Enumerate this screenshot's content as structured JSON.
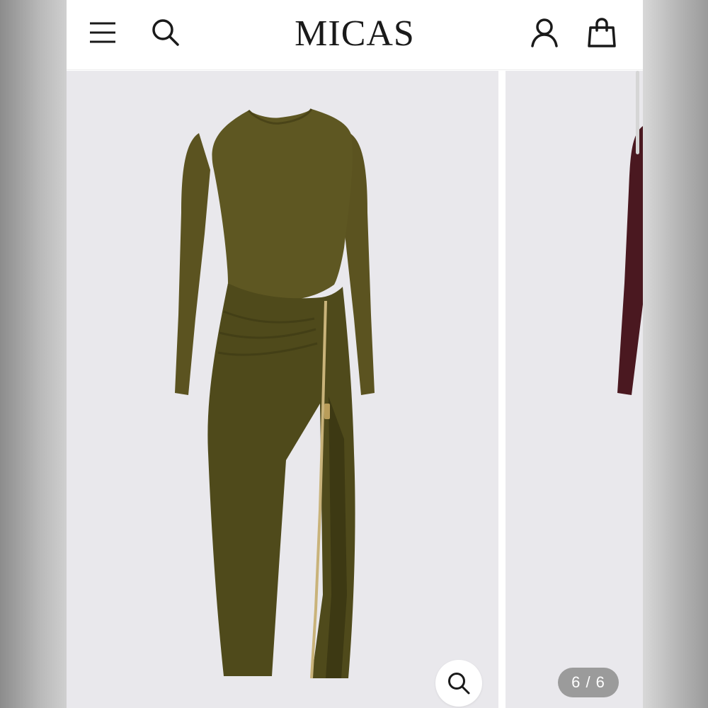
{
  "header": {
    "brand": "MICAS",
    "menu_icon": "hamburger-menu-icon",
    "search_icon": "search-icon",
    "account_icon": "user-icon",
    "cart_icon": "shopping-bag-icon"
  },
  "gallery": {
    "counter": "6 / 6",
    "zoom_icon": "zoom-search-icon",
    "main_product_color": "#5b5320",
    "next_product_color": "#4a1820"
  }
}
